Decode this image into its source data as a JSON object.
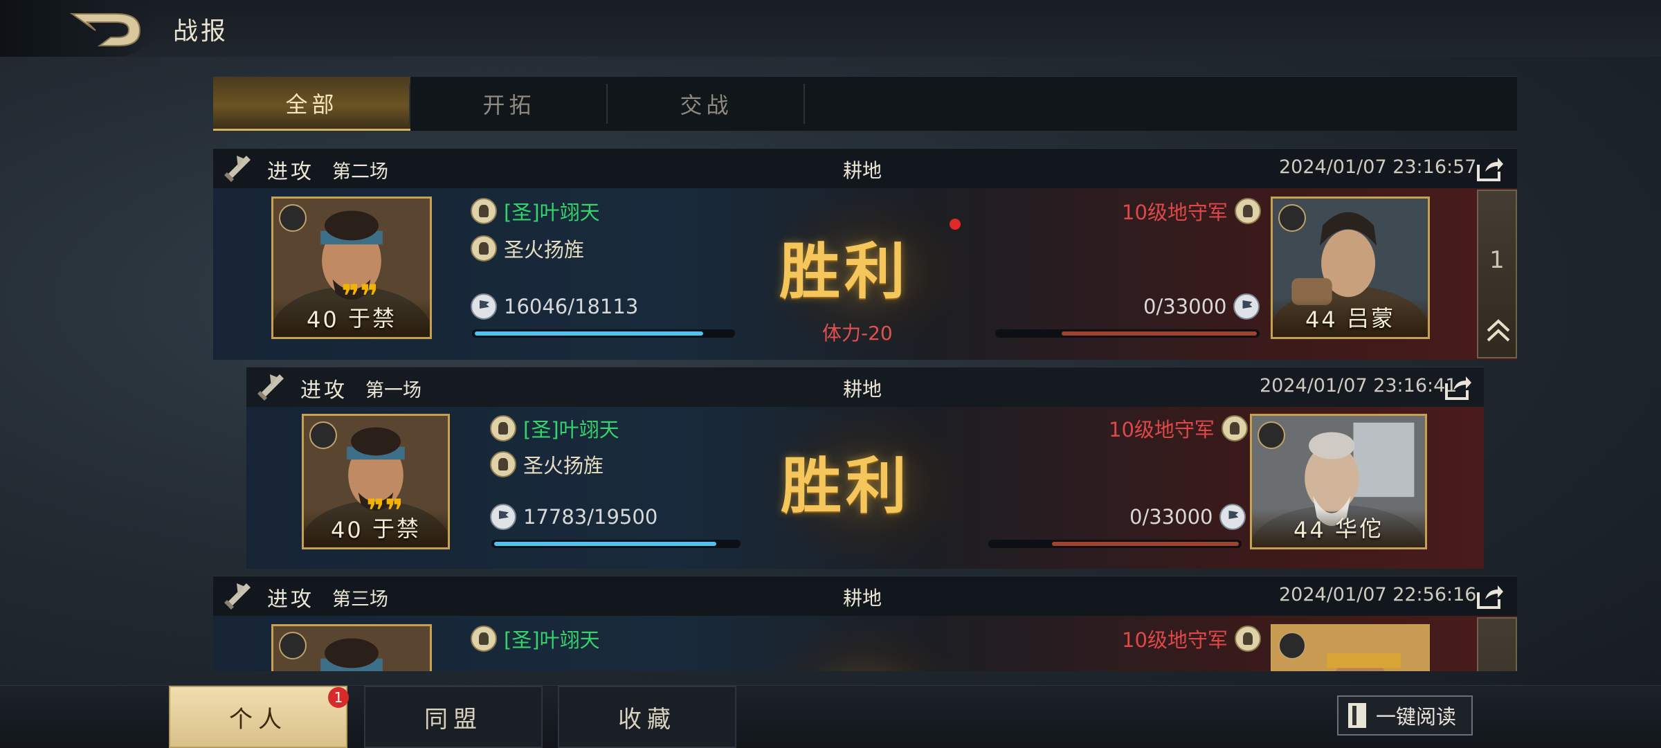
{
  "header": {
    "title": "战报"
  },
  "tabs": [
    {
      "label": "全部",
      "active": true
    },
    {
      "label": "开拓",
      "active": false
    },
    {
      "label": "交战",
      "active": false
    }
  ],
  "reports": [
    {
      "mode": "进攻",
      "round": "第二场",
      "place": "耕地",
      "time": "2024/01/07 23:16:57",
      "attacker": {
        "tag": "[圣]叶翊天",
        "tactic": "圣火扬旌",
        "troops": "16046/18113",
        "troops_ratio": 0.886,
        "level": "40",
        "name": "于禁"
      },
      "defender": {
        "title": "10级地守军",
        "troops": "0/33000",
        "troops_ratio": 0.0,
        "level": "44",
        "name": "吕蒙"
      },
      "result": "胜利",
      "stamina": "体力-20",
      "unread": true,
      "page_count": "1"
    },
    {
      "mode": "进攻",
      "round": "第一场",
      "place": "耕地",
      "time": "2024/01/07 23:16:41",
      "attacker": {
        "tag": "[圣]叶翊天",
        "tactic": "圣火扬旌",
        "troops": "17783/19500",
        "troops_ratio": 0.912,
        "level": "40",
        "name": "于禁"
      },
      "defender": {
        "title": "10级地守军",
        "troops": "0/33000",
        "troops_ratio": 0.0,
        "level": "44",
        "name": "华佗"
      },
      "result": "胜利",
      "stamina": "",
      "unread": false
    },
    {
      "mode": "进攻",
      "round": "第三场",
      "place": "耕地",
      "time": "2024/01/07 22:56:16",
      "attacker": {
        "tag": "[圣]叶翊天"
      },
      "defender": {
        "title": "10级地守军"
      }
    }
  ],
  "bottom_tabs": [
    {
      "label": "个人",
      "active": true,
      "badge": "1"
    },
    {
      "label": "同盟",
      "active": false
    },
    {
      "label": "收藏",
      "active": false
    }
  ],
  "read_all_label": "一键阅读",
  "colors": {
    "accent_gold": "#d8b25a",
    "ally_green": "#35d46b",
    "enemy_red": "#e04848",
    "troop_bar_blue": "#4cc3f2"
  }
}
